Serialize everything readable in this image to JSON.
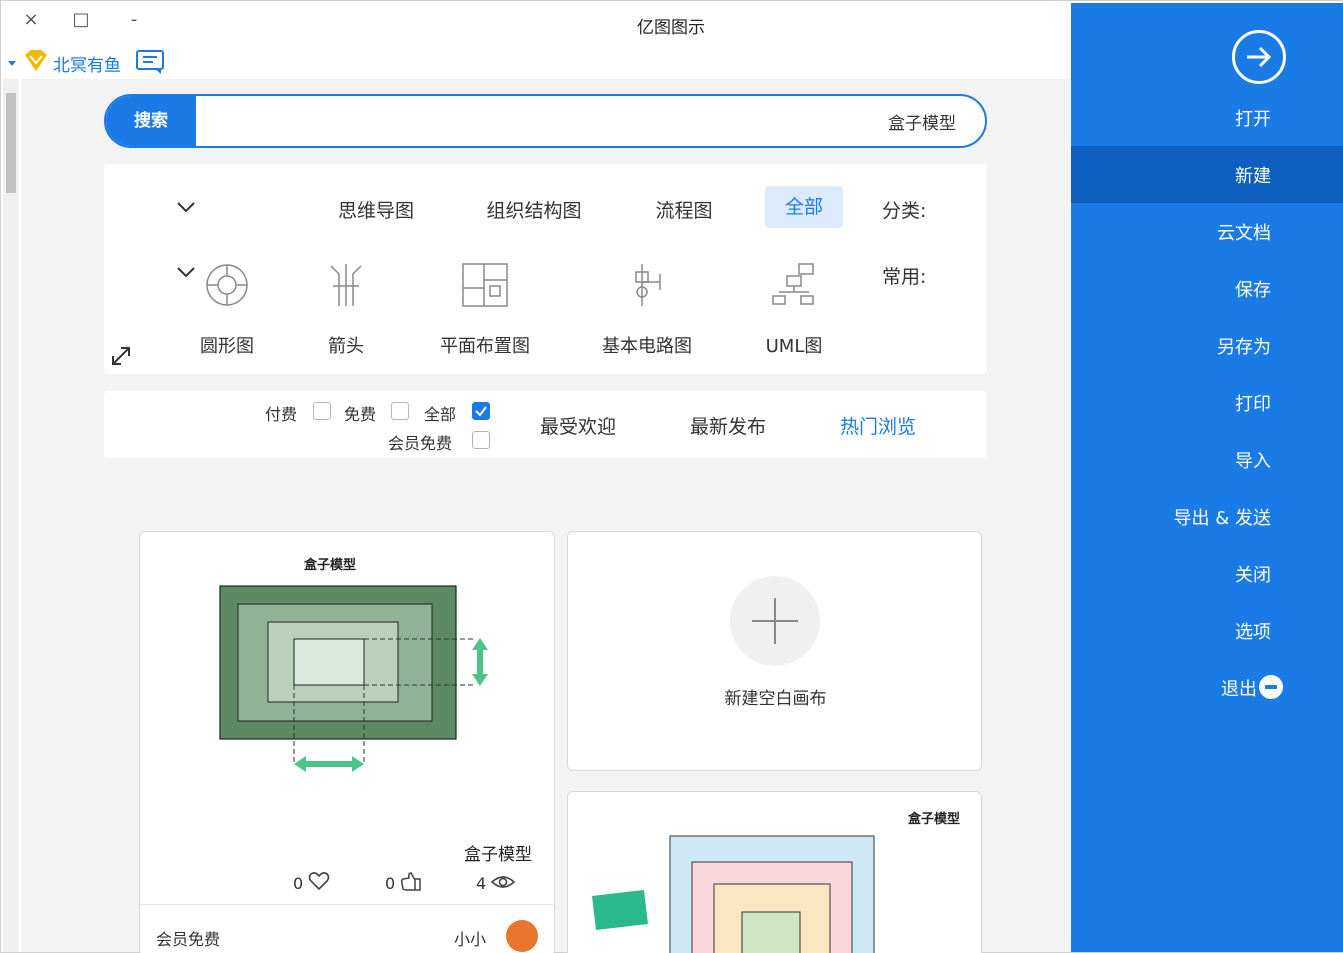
{
  "window": {
    "title": "亿图图示",
    "minimize": "-",
    "maximize": "□",
    "close": "×"
  },
  "user": {
    "name": "北冥有鱼"
  },
  "sidebar": {
    "items": [
      {
        "label": "打开"
      },
      {
        "label": "新建"
      },
      {
        "label": "云文档"
      },
      {
        "label": "保存"
      },
      {
        "label": "另存为"
      },
      {
        "label": "打印"
      },
      {
        "label": "导入"
      },
      {
        "label": "导出 & 发送"
      },
      {
        "label": "关闭"
      },
      {
        "label": "选项"
      },
      {
        "label": "退出"
      }
    ],
    "active_index": 1,
    "accent": "#1a7ae6"
  },
  "search": {
    "button_label": "搜索",
    "value": "盒子模型"
  },
  "categories": {
    "label": "分类:",
    "tabs": [
      {
        "label": "全部"
      },
      {
        "label": "流程图"
      },
      {
        "label": "组织结构图"
      },
      {
        "label": "思维导图"
      }
    ],
    "active_index": 0,
    "common_label": "常用:",
    "common_items": [
      {
        "label": "UML图",
        "icon": "uml-icon"
      },
      {
        "label": "基本电路图",
        "icon": "circuit-icon"
      },
      {
        "label": "平面布置图",
        "icon": "floorplan-icon"
      },
      {
        "label": "箭头",
        "icon": "arrow-shape-icon"
      },
      {
        "label": "圆形图",
        "icon": "circle-chart-icon"
      }
    ]
  },
  "sort": {
    "tabs": [
      {
        "label": "热门浏览"
      },
      {
        "label": "最新发布"
      },
      {
        "label": "最受欢迎"
      }
    ],
    "active_index": 0
  },
  "filters": {
    "all": "全部",
    "free": "免费",
    "paid": "付费",
    "member_free": "会员免费",
    "all_checked": true
  },
  "cards": {
    "template": {
      "thumb_title": "盒子模型",
      "name": "盒子模型",
      "views": "4",
      "likes": "0",
      "favorites": "0",
      "author": "小小",
      "price": "会员免费"
    },
    "new_blank": {
      "label": "新建空白画布"
    },
    "second_template": {
      "thumb_title": "盒子模型"
    }
  }
}
